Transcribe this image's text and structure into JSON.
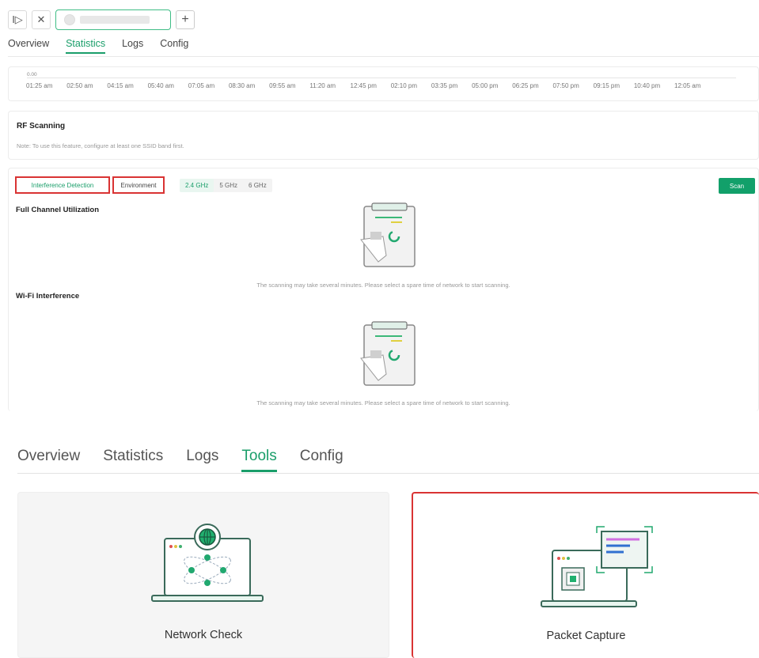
{
  "top_bar": {
    "sidebar_toggle_glyph": "I▷",
    "close_glyph": "✕",
    "add_glyph": "+"
  },
  "tabs_small": [
    "Overview",
    "Statistics",
    "Logs",
    "Config"
  ],
  "tabs_small_active": "Statistics",
  "chart": {
    "zero_label": "0.00",
    "time_ticks": [
      "01:25 am",
      "02:50 am",
      "04:15 am",
      "05:40 am",
      "07:05 am",
      "08:30 am",
      "09:55 am",
      "11:20 am",
      "12:45 pm",
      "02:10 pm",
      "03:35 pm",
      "05:00 pm",
      "06:25 pm",
      "07:50 pm",
      "09:15 pm",
      "10:40 pm",
      "12:05 am"
    ]
  },
  "rf_scanning": {
    "title": "RF Scanning",
    "note": "Note: To use this feature, configure at least one SSID band first."
  },
  "scan_panel": {
    "mode_buttons": [
      "Interference Detection",
      "Environment"
    ],
    "bands": [
      "2.4 GHz",
      "5 GHz",
      "6 GHz"
    ],
    "selected_band": "2.4 GHz",
    "scan_label": "Scan",
    "section1": "Full Channel Utilization",
    "section2": "Wi-Fi Interference",
    "message": "The scanning may take several minutes. Please select a spare time of network to start scanning."
  },
  "tabs_large": [
    "Overview",
    "Statistics",
    "Logs",
    "Tools",
    "Config"
  ],
  "tabs_large_active": "Tools",
  "tools": [
    {
      "label": "Network Check",
      "icon": "network-check-icon"
    },
    {
      "label": "Packet Capture",
      "icon": "packet-capture-icon"
    }
  ],
  "colors": {
    "accent": "#1a9e6a",
    "highlight": "#d93333"
  }
}
